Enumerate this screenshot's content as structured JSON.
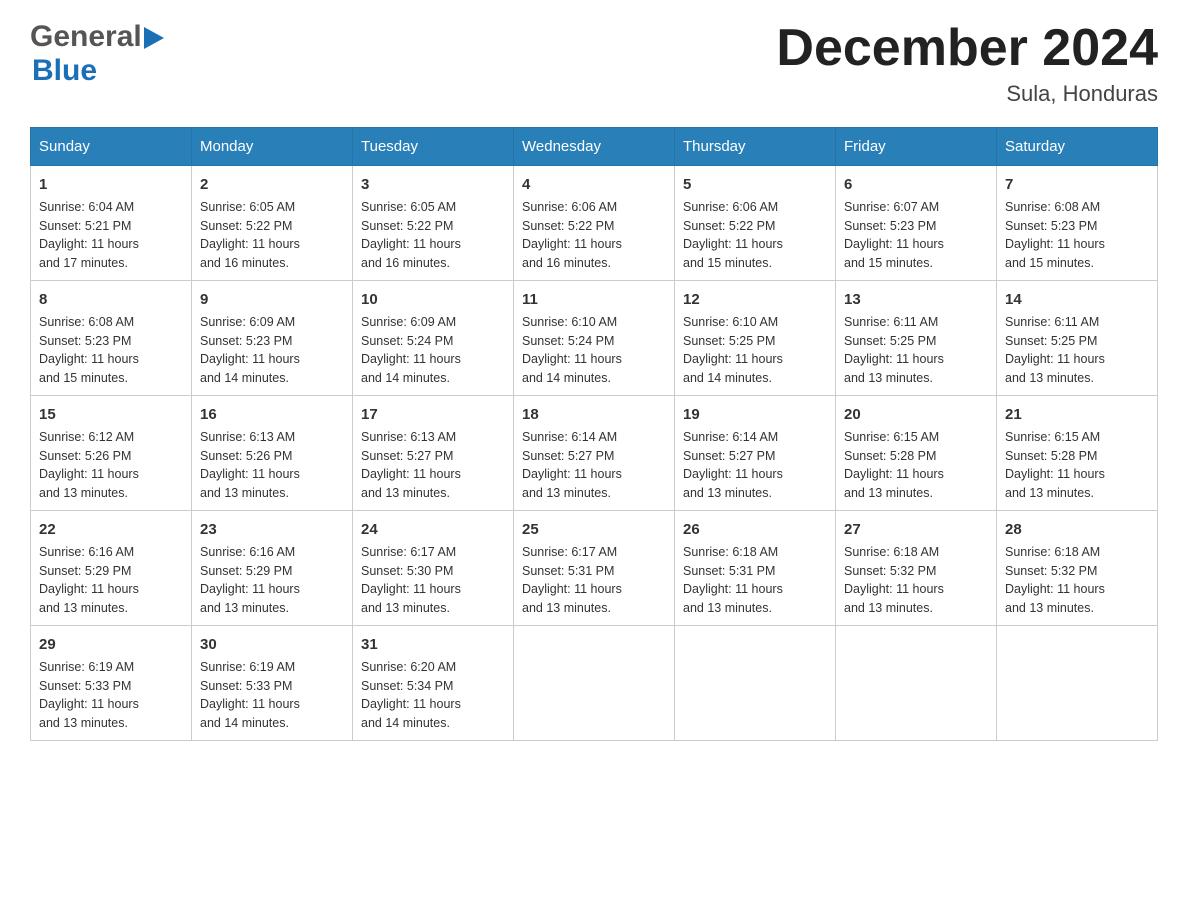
{
  "logo": {
    "general": "General",
    "blue": "Blue",
    "arrow": "▶"
  },
  "header": {
    "title": "December 2024",
    "subtitle": "Sula, Honduras"
  },
  "columns": [
    "Sunday",
    "Monday",
    "Tuesday",
    "Wednesday",
    "Thursday",
    "Friday",
    "Saturday"
  ],
  "weeks": [
    [
      {
        "day": "1",
        "info": "Sunrise: 6:04 AM\nSunset: 5:21 PM\nDaylight: 11 hours\nand 17 minutes."
      },
      {
        "day": "2",
        "info": "Sunrise: 6:05 AM\nSunset: 5:22 PM\nDaylight: 11 hours\nand 16 minutes."
      },
      {
        "day": "3",
        "info": "Sunrise: 6:05 AM\nSunset: 5:22 PM\nDaylight: 11 hours\nand 16 minutes."
      },
      {
        "day": "4",
        "info": "Sunrise: 6:06 AM\nSunset: 5:22 PM\nDaylight: 11 hours\nand 16 minutes."
      },
      {
        "day": "5",
        "info": "Sunrise: 6:06 AM\nSunset: 5:22 PM\nDaylight: 11 hours\nand 15 minutes."
      },
      {
        "day": "6",
        "info": "Sunrise: 6:07 AM\nSunset: 5:23 PM\nDaylight: 11 hours\nand 15 minutes."
      },
      {
        "day": "7",
        "info": "Sunrise: 6:08 AM\nSunset: 5:23 PM\nDaylight: 11 hours\nand 15 minutes."
      }
    ],
    [
      {
        "day": "8",
        "info": "Sunrise: 6:08 AM\nSunset: 5:23 PM\nDaylight: 11 hours\nand 15 minutes."
      },
      {
        "day": "9",
        "info": "Sunrise: 6:09 AM\nSunset: 5:23 PM\nDaylight: 11 hours\nand 14 minutes."
      },
      {
        "day": "10",
        "info": "Sunrise: 6:09 AM\nSunset: 5:24 PM\nDaylight: 11 hours\nand 14 minutes."
      },
      {
        "day": "11",
        "info": "Sunrise: 6:10 AM\nSunset: 5:24 PM\nDaylight: 11 hours\nand 14 minutes."
      },
      {
        "day": "12",
        "info": "Sunrise: 6:10 AM\nSunset: 5:25 PM\nDaylight: 11 hours\nand 14 minutes."
      },
      {
        "day": "13",
        "info": "Sunrise: 6:11 AM\nSunset: 5:25 PM\nDaylight: 11 hours\nand 13 minutes."
      },
      {
        "day": "14",
        "info": "Sunrise: 6:11 AM\nSunset: 5:25 PM\nDaylight: 11 hours\nand 13 minutes."
      }
    ],
    [
      {
        "day": "15",
        "info": "Sunrise: 6:12 AM\nSunset: 5:26 PM\nDaylight: 11 hours\nand 13 minutes."
      },
      {
        "day": "16",
        "info": "Sunrise: 6:13 AM\nSunset: 5:26 PM\nDaylight: 11 hours\nand 13 minutes."
      },
      {
        "day": "17",
        "info": "Sunrise: 6:13 AM\nSunset: 5:27 PM\nDaylight: 11 hours\nand 13 minutes."
      },
      {
        "day": "18",
        "info": "Sunrise: 6:14 AM\nSunset: 5:27 PM\nDaylight: 11 hours\nand 13 minutes."
      },
      {
        "day": "19",
        "info": "Sunrise: 6:14 AM\nSunset: 5:27 PM\nDaylight: 11 hours\nand 13 minutes."
      },
      {
        "day": "20",
        "info": "Sunrise: 6:15 AM\nSunset: 5:28 PM\nDaylight: 11 hours\nand 13 minutes."
      },
      {
        "day": "21",
        "info": "Sunrise: 6:15 AM\nSunset: 5:28 PM\nDaylight: 11 hours\nand 13 minutes."
      }
    ],
    [
      {
        "day": "22",
        "info": "Sunrise: 6:16 AM\nSunset: 5:29 PM\nDaylight: 11 hours\nand 13 minutes."
      },
      {
        "day": "23",
        "info": "Sunrise: 6:16 AM\nSunset: 5:29 PM\nDaylight: 11 hours\nand 13 minutes."
      },
      {
        "day": "24",
        "info": "Sunrise: 6:17 AM\nSunset: 5:30 PM\nDaylight: 11 hours\nand 13 minutes."
      },
      {
        "day": "25",
        "info": "Sunrise: 6:17 AM\nSunset: 5:31 PM\nDaylight: 11 hours\nand 13 minutes."
      },
      {
        "day": "26",
        "info": "Sunrise: 6:18 AM\nSunset: 5:31 PM\nDaylight: 11 hours\nand 13 minutes."
      },
      {
        "day": "27",
        "info": "Sunrise: 6:18 AM\nSunset: 5:32 PM\nDaylight: 11 hours\nand 13 minutes."
      },
      {
        "day": "28",
        "info": "Sunrise: 6:18 AM\nSunset: 5:32 PM\nDaylight: 11 hours\nand 13 minutes."
      }
    ],
    [
      {
        "day": "29",
        "info": "Sunrise: 6:19 AM\nSunset: 5:33 PM\nDaylight: 11 hours\nand 13 minutes."
      },
      {
        "day": "30",
        "info": "Sunrise: 6:19 AM\nSunset: 5:33 PM\nDaylight: 11 hours\nand 14 minutes."
      },
      {
        "day": "31",
        "info": "Sunrise: 6:20 AM\nSunset: 5:34 PM\nDaylight: 11 hours\nand 14 minutes."
      },
      {
        "day": "",
        "info": ""
      },
      {
        "day": "",
        "info": ""
      },
      {
        "day": "",
        "info": ""
      },
      {
        "day": "",
        "info": ""
      }
    ]
  ]
}
